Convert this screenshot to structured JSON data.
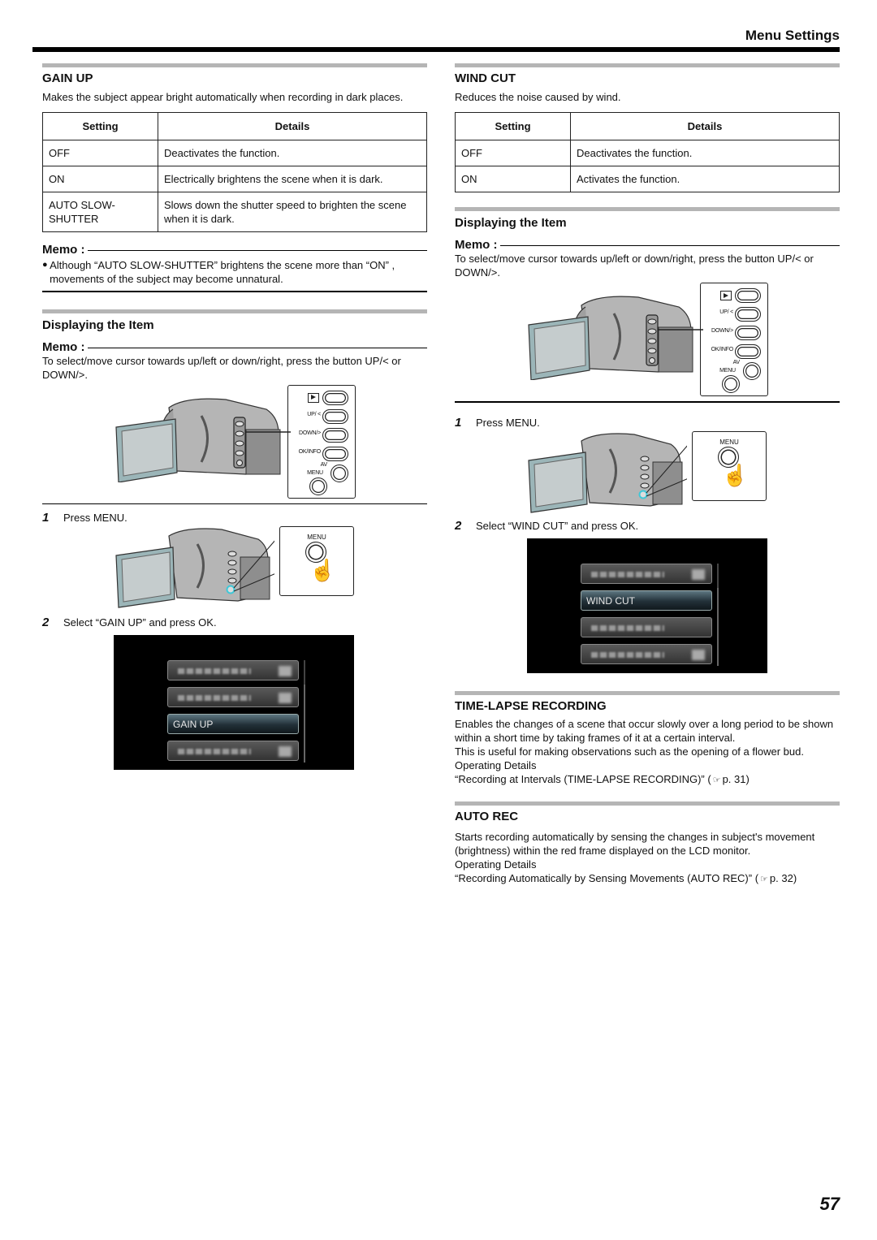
{
  "header": {
    "title": "Menu Settings"
  },
  "gain_up": {
    "title": "GAIN UP",
    "description": "Makes the subject appear bright automatically when recording in dark places.",
    "table": {
      "headers": [
        "Setting",
        "Details"
      ],
      "rows": [
        {
          "setting": "OFF",
          "details": "Deactivates the function."
        },
        {
          "setting": "ON",
          "details": "Electrically brightens the scene when it is dark."
        },
        {
          "setting": "AUTO SLOW-SHUTTER",
          "details": "Slows down the shutter speed to brighten the scene when it is dark."
        }
      ]
    },
    "memo": {
      "label": "Memo :",
      "bullet": "Although “AUTO SLOW-SHUTTER” brightens the scene more than “ON” , movements of the subject may become unnatural."
    },
    "displaying": {
      "title": "Displaying the Item",
      "memo_label": "Memo :",
      "memo_text": "To select/move cursor towards up/left or down/right, press the button UP/< or DOWN/>.",
      "button_labels": {
        "play": "▶",
        "up": "UP/ <",
        "down": "DOWN/>",
        "ok": "OK/INFO",
        "av": "AV",
        "menu": "MENU"
      },
      "steps": [
        {
          "num": "1",
          "text": "Press MENU.",
          "panel_label": "MENU"
        },
        {
          "num": "2",
          "text": "Select “GAIN UP” and press OK."
        }
      ],
      "lcd_rows": [
        "",
        "",
        "GAIN UP",
        ""
      ],
      "lcd_selected_index": 2
    }
  },
  "wind_cut": {
    "title": "WIND CUT",
    "description": "Reduces the noise caused by wind.",
    "table": {
      "headers": [
        "Setting",
        "Details"
      ],
      "rows": [
        {
          "setting": "OFF",
          "details": "Deactivates the function."
        },
        {
          "setting": "ON",
          "details": "Activates the function."
        }
      ]
    },
    "displaying": {
      "title": "Displaying the Item",
      "memo_label": "Memo :",
      "memo_text": "To select/move cursor towards up/left or down/right, press the button UP/< or DOWN/>.",
      "button_labels": {
        "play": "▶",
        "up": "UP/ <",
        "down": "DOWN/>",
        "ok": "OK/INFO",
        "av": "AV",
        "menu": "MENU"
      },
      "steps": [
        {
          "num": "1",
          "text": "Press MENU.",
          "panel_label": "MENU"
        },
        {
          "num": "2",
          "text": "Select “WIND CUT” and press OK."
        }
      ],
      "lcd_rows": [
        "",
        "WIND CUT",
        "",
        ""
      ],
      "lcd_selected_index": 1
    }
  },
  "time_lapse": {
    "title": "TIME-LAPSE RECORDING",
    "lines": [
      "Enables the changes of a scene that occur slowly over a long period to be shown within a short time by taking frames of it at a certain interval.",
      "This is useful for making observations such as the opening of a flower bud."
    ],
    "operating_label": "Operating Details",
    "link_text": "“Recording at Intervals (TIME-LAPSE RECORDING)”",
    "ref_icon": "☞",
    "page_ref": "p. 31)",
    "paren_open": "("
  },
  "auto_rec": {
    "title": "AUTO REC",
    "lines": [
      "Starts recording automatically by sensing the changes in subject's movement (brightness) within the red frame displayed on the LCD monitor."
    ],
    "operating_label": "Operating Details",
    "link_text": "“Recording Automatically by Sensing Movements (AUTO REC)”",
    "ref_icon": "☞",
    "page_ref": "p. 32)",
    "paren_open": "("
  },
  "page_number": "57"
}
